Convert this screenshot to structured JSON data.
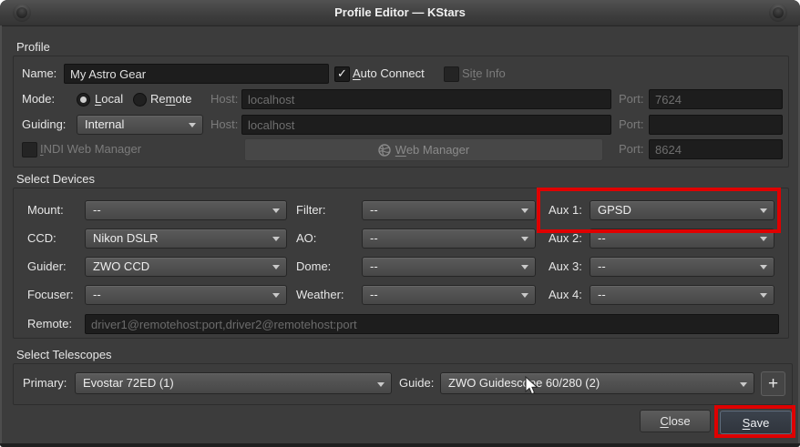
{
  "window": {
    "title": "Profile Editor — KStars"
  },
  "profile": {
    "section_label": "Profile",
    "name_label": "Name:",
    "name_value": "My Astro Gear",
    "auto_connect_label": "&Auto Connect",
    "auto_connect_checked": true,
    "site_info_label": "Si&te Info",
    "mode_label": "Mode:",
    "local_label": "&Local",
    "remote_label": "Re&mote",
    "host_label": "Host:",
    "host_value": "localhost",
    "port_label": "Port:",
    "port_value": "7624",
    "guiding_label": "Guiding:",
    "guiding_value": "Internal",
    "guiding_host_value": "localhost",
    "guiding_port_value": "",
    "indi_web_label": "&INDI Web Manager",
    "web_manager_button": "&Web Manager",
    "web_port_value": "8624"
  },
  "devices": {
    "section_label": "Select Devices",
    "grid": [
      {
        "label": "Mount:",
        "value": "--"
      },
      {
        "label": "Filter:",
        "value": "--"
      },
      {
        "label": "Aux 1:",
        "value": "GPSD"
      },
      {
        "label": "CCD:",
        "value": "Nikon DSLR"
      },
      {
        "label": "AO:",
        "value": "--"
      },
      {
        "label": "Aux 2:",
        "value": "--"
      },
      {
        "label": "Guider:",
        "value": "ZWO CCD"
      },
      {
        "label": "Dome:",
        "value": "--"
      },
      {
        "label": "Aux 3:",
        "value": "--"
      },
      {
        "label": "Focuser:",
        "value": "--"
      },
      {
        "label": "Weather:",
        "value": "--"
      },
      {
        "label": "Aux 4:",
        "value": "--"
      }
    ],
    "remote_label": "Remote:",
    "remote_placeholder": "driver1@remotehost:port,driver2@remotehost:port"
  },
  "telescopes": {
    "section_label": "Select Telescopes",
    "primary_label": "Primary:",
    "primary_value": "Evostar 72ED (1)",
    "guide_label": "Guide:",
    "guide_value": "ZWO Guidescope 60/280 (2)"
  },
  "footer": {
    "close_label": "&Close",
    "save_label": "&Save"
  },
  "icons": {
    "check": "✓",
    "plus": "+",
    "chevron_down": "▾",
    "globe": "🌐",
    "cursor": "arrow-pointer"
  },
  "annotations": {
    "highlight_color": "#df0000",
    "highlighted": [
      "aux1-select",
      "save-button"
    ]
  }
}
